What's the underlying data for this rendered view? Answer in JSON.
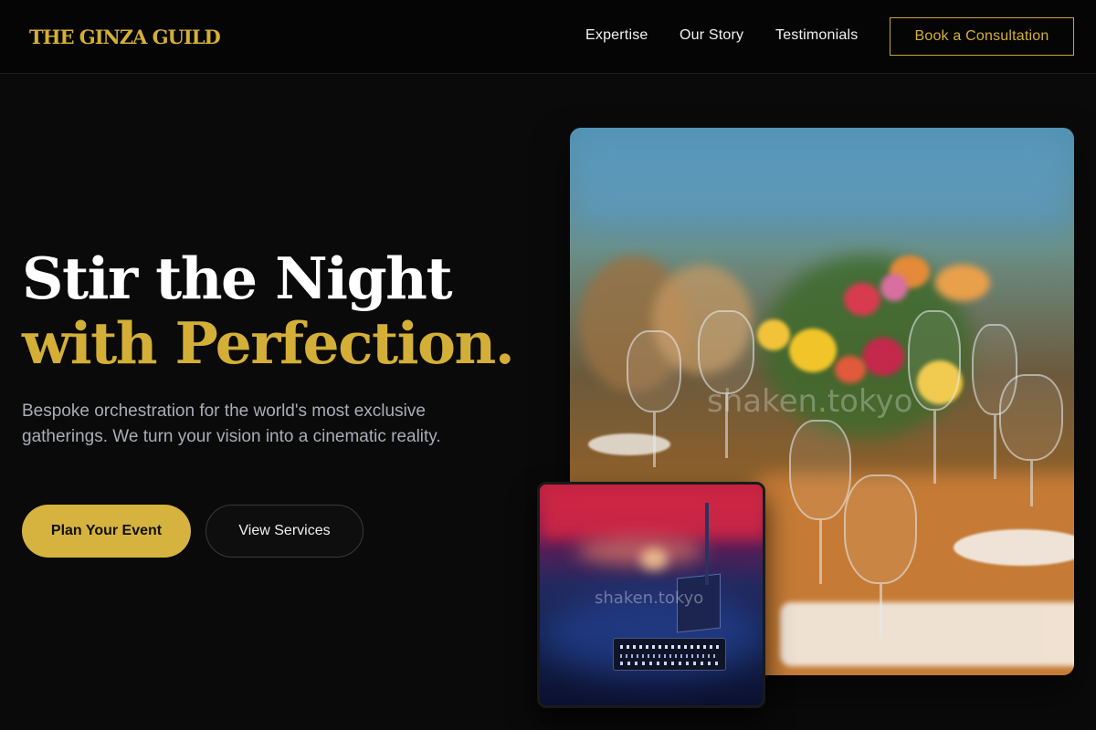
{
  "nav": {
    "brand": "THE GINZA GUILD",
    "links": [
      "Expertise",
      "Our Story",
      "Testimonials"
    ],
    "cta": "Book a Consultation"
  },
  "hero": {
    "title_line1": "Stir the Night",
    "title_line2": "with Perfection.",
    "subtitle": "Bespoke orchestration for the world's most exclusive gatherings. We turn your vision into a cinematic reality.",
    "primary_button": "Plan Your Event",
    "secondary_button": "View Services"
  },
  "images": {
    "main_watermark": "shaken.tokyo",
    "small_watermark": "shaken.tokyo"
  },
  "colors": {
    "accent_gold": "#d4af37",
    "background": "#0a0a0a"
  }
}
